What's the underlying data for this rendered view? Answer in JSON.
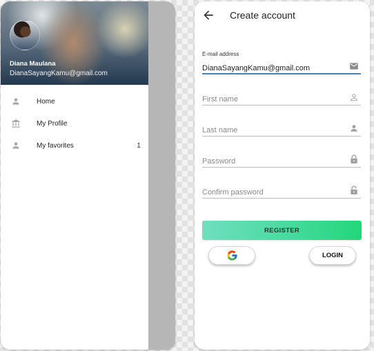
{
  "drawer": {
    "user_name": "Diana Maulana",
    "user_email": "DianaSayangKamu@gmail.com",
    "avatar_icon": "user-photo",
    "items": [
      {
        "label": "Home",
        "icon": "person-icon",
        "badge": ""
      },
      {
        "label": "My Profile",
        "icon": "bank-icon",
        "badge": ""
      },
      {
        "label": "My favorites",
        "icon": "person-icon",
        "badge": "1"
      }
    ]
  },
  "register": {
    "title": "Create account",
    "back_icon": "arrow-back-icon",
    "fields": [
      {
        "label": "E-mail address",
        "value": "DianaSayangKamu@gmail.com",
        "placeholder": "",
        "icon": "mail-icon"
      },
      {
        "label": "",
        "value": "",
        "placeholder": "First name",
        "icon": "person-outline-icon"
      },
      {
        "label": "",
        "value": "",
        "placeholder": "Last name",
        "icon": "person-icon"
      },
      {
        "label": "",
        "value": "",
        "placeholder": "Password",
        "icon": "lock-icon"
      },
      {
        "label": "",
        "value": "",
        "placeholder": "Confirm password",
        "icon": "lock-open-icon"
      }
    ],
    "register_label": "REGISTER",
    "google_icon": "google-g-icon",
    "login_label": "LOGIN"
  },
  "colors": {
    "accent_underline": "#4b7fad",
    "register_gradient_start": "#6fdfbd",
    "register_gradient_end": "#22d77a",
    "icon_gray": "#9e9e9e",
    "scrim": "#b6b6b6"
  }
}
